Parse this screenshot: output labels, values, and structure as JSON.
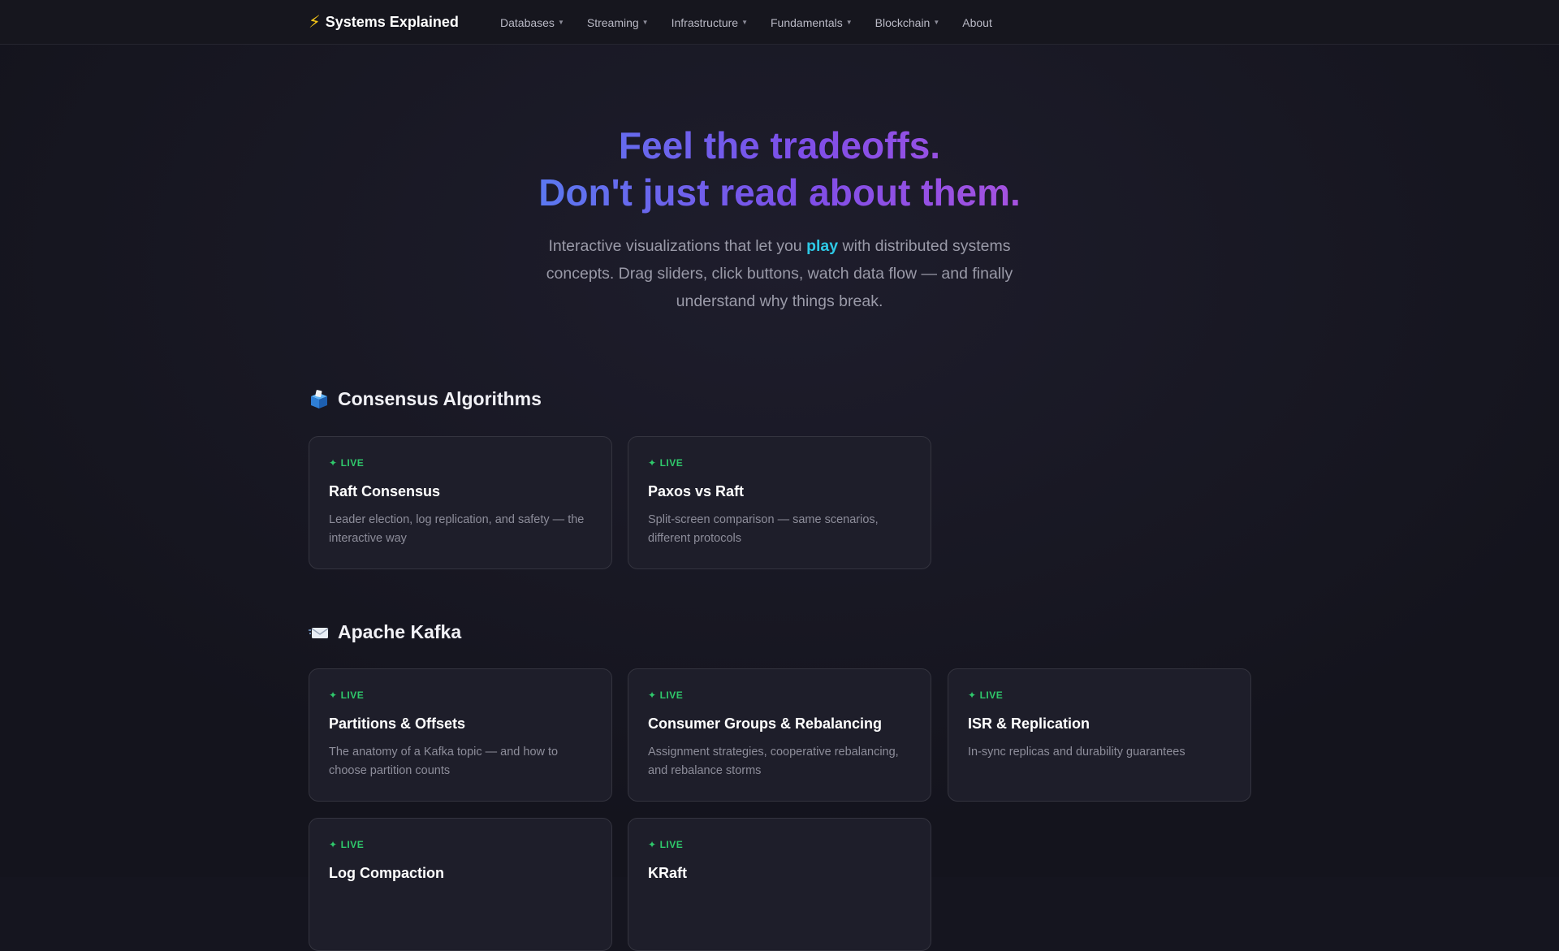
{
  "header": {
    "brand_icon": "⚡",
    "brand_name": "Systems Explained",
    "nav": [
      {
        "label": "Databases",
        "dropdown": true
      },
      {
        "label": "Streaming",
        "dropdown": true
      },
      {
        "label": "Infrastructure",
        "dropdown": true
      },
      {
        "label": "Fundamentals",
        "dropdown": true
      },
      {
        "label": "Blockchain",
        "dropdown": true
      },
      {
        "label": "About",
        "dropdown": false
      }
    ]
  },
  "hero": {
    "title_line1": "Feel the tradeoffs.",
    "title_line2": "Don't just read about them.",
    "subtitle_before": "Interactive visualizations that let you ",
    "subtitle_highlight": "play",
    "subtitle_after": " with distributed systems concepts. Drag sliders, click buttons, watch data flow — and finally understand why things break."
  },
  "sections": [
    {
      "icon": "ballot-box-icon",
      "title": "Consensus Algorithms",
      "cards": [
        {
          "badge": "LIVE",
          "title": "Raft Consensus",
          "desc": "Leader election, log replication, and safety — the interactive way"
        },
        {
          "badge": "LIVE",
          "title": "Paxos vs Raft",
          "desc": "Split-screen comparison — same scenarios, different protocols"
        }
      ]
    },
    {
      "icon": "envelope-icon",
      "title": "Apache Kafka",
      "cards": [
        {
          "badge": "LIVE",
          "title": "Partitions & Offsets",
          "desc": "The anatomy of a Kafka topic — and how to choose partition counts"
        },
        {
          "badge": "LIVE",
          "title": "Consumer Groups & Rebalancing",
          "desc": "Assignment strategies, cooperative rebalancing, and rebalance storms"
        },
        {
          "badge": "LIVE",
          "title": "ISR & Replication",
          "desc": "In-sync replicas and durability guarantees"
        },
        {
          "badge": "LIVE",
          "title": "Log Compaction",
          "desc": ""
        },
        {
          "badge": "LIVE",
          "title": "KRaft",
          "desc": ""
        }
      ]
    }
  ],
  "colors": {
    "accent_live": "#2fc86b",
    "accent_highlight": "#2ec9e6",
    "gradient_start": "#5b78f0",
    "gradient_end": "#a652e0"
  }
}
